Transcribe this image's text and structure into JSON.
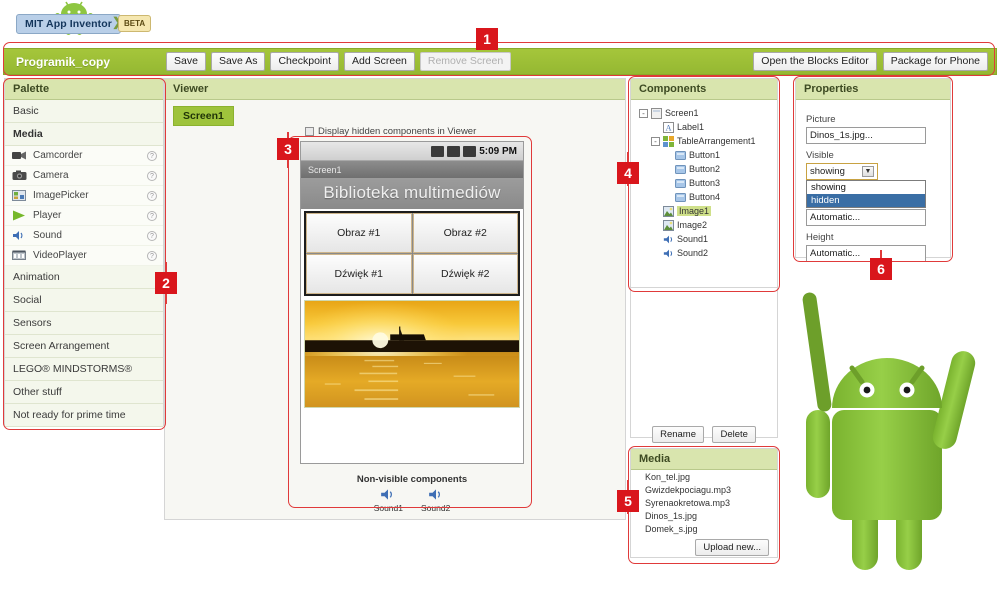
{
  "brand": {
    "name": "MIT App Inventor",
    "badge": "BETA",
    "logo_icon": "android-robot-icon"
  },
  "projectbar": {
    "project_name": "Programik_copy",
    "buttons": [
      {
        "label": "Save",
        "disabled": false
      },
      {
        "label": "Save As",
        "disabled": false
      },
      {
        "label": "Checkpoint",
        "disabled": false
      },
      {
        "label": "Add Screen",
        "disabled": false
      },
      {
        "label": "Remove Screen",
        "disabled": true
      }
    ],
    "right_buttons": [
      {
        "label": "Open the Blocks Editor"
      },
      {
        "label": "Package for Phone"
      }
    ]
  },
  "palette": {
    "title": "Palette",
    "groups": [
      {
        "label": "Basic",
        "bold": false,
        "open": false
      },
      {
        "label": "Media",
        "bold": true,
        "open": true
      },
      {
        "label": "Animation",
        "bold": false,
        "open": false
      },
      {
        "label": "Social",
        "bold": false,
        "open": false
      },
      {
        "label": "Sensors",
        "bold": false,
        "open": false
      },
      {
        "label": "Screen Arrangement",
        "bold": false,
        "open": false
      },
      {
        "label": "LEGO® MINDSTORMS®",
        "bold": false,
        "open": false
      },
      {
        "label": "Other stuff",
        "bold": false,
        "open": false
      },
      {
        "label": "Not ready for prime time",
        "bold": false,
        "open": false
      }
    ],
    "media_items": [
      {
        "label": "Camcorder",
        "icon": "camcorder-icon",
        "help": "?"
      },
      {
        "label": "Camera",
        "icon": "camera-icon",
        "help": "?"
      },
      {
        "label": "ImagePicker",
        "icon": "imagepicker-icon",
        "help": "?"
      },
      {
        "label": "Player",
        "icon": "player-play-icon",
        "help": "?"
      },
      {
        "label": "Sound",
        "icon": "sound-speaker-icon",
        "help": "?"
      },
      {
        "label": "VideoPlayer",
        "icon": "videoplayer-icon",
        "help": "?"
      }
    ]
  },
  "viewer": {
    "title": "Viewer",
    "screen_tab": "Screen1",
    "hidden_checkbox_label": "Display hidden components in Viewer",
    "hidden_checkbox_checked": false,
    "phone": {
      "status_time": "5:09 PM",
      "status_icons": [
        "signal-bars-icon",
        "network-icon",
        "battery-icon"
      ],
      "screen_title": "Screen1",
      "app_label": "Biblioteka multimediów",
      "buttons": [
        "Obraz #1",
        "Obraz #2",
        "Dźwięk #1",
        "Dźwięk #2"
      ],
      "image_alt": "sunset-harbor-photo"
    },
    "nonvisible_title": "Non-visible components",
    "nonvisible": [
      {
        "label": "Sound1",
        "icon": "sound-speaker-icon"
      },
      {
        "label": "Sound2",
        "icon": "sound-speaker-icon"
      }
    ]
  },
  "components": {
    "title": "Components",
    "tree": [
      {
        "label": "Screen1",
        "depth": 0,
        "toggle": "-",
        "icon": "screen-icon",
        "selected": false
      },
      {
        "label": "Label1",
        "depth": 1,
        "toggle": "",
        "icon": "label-icon",
        "selected": false
      },
      {
        "label": "TableArrangement1",
        "depth": 1,
        "toggle": "-",
        "icon": "table-icon",
        "selected": false
      },
      {
        "label": "Button1",
        "depth": 2,
        "toggle": "",
        "icon": "button-icon",
        "selected": false
      },
      {
        "label": "Button2",
        "depth": 2,
        "toggle": "",
        "icon": "button-icon",
        "selected": false
      },
      {
        "label": "Button3",
        "depth": 2,
        "toggle": "",
        "icon": "button-icon",
        "selected": false
      },
      {
        "label": "Button4",
        "depth": 2,
        "toggle": "",
        "icon": "button-icon",
        "selected": false
      },
      {
        "label": "Image1",
        "depth": 1,
        "toggle": "",
        "icon": "image-icon",
        "selected": true
      },
      {
        "label": "Image2",
        "depth": 1,
        "toggle": "",
        "icon": "image-icon",
        "selected": false
      },
      {
        "label": "Sound1",
        "depth": 1,
        "toggle": "",
        "icon": "sound-speaker-icon",
        "selected": false
      },
      {
        "label": "Sound2",
        "depth": 1,
        "toggle": "",
        "icon": "sound-speaker-icon",
        "selected": false
      }
    ],
    "rename_label": "Rename",
    "delete_label": "Delete"
  },
  "media_panel": {
    "title": "Media",
    "files": [
      "Kon_tel.jpg",
      "Gwizdekpociagu.mp3",
      "Syrenaokretowa.mp3",
      "Dinos_1s.jpg",
      "Domek_s.jpg"
    ],
    "upload_label": "Upload new..."
  },
  "properties": {
    "title": "Properties",
    "picture_label": "Picture",
    "picture_value": "Dinos_1s.jpg...",
    "visible_label": "Visible",
    "visible_value": "showing",
    "visible_options": [
      {
        "label": "showing",
        "selected": false
      },
      {
        "label": "hidden",
        "selected": true
      }
    ],
    "width_value": "Automatic...",
    "height_label": "Height",
    "height_value": "Automatic..."
  },
  "callouts": [
    {
      "number": "1"
    },
    {
      "number": "2"
    },
    {
      "number": "3"
    },
    {
      "number": "4"
    },
    {
      "number": "5"
    },
    {
      "number": "6"
    }
  ],
  "colors": {
    "accent_green": "#9ec33c",
    "panel_head": "#d9e5ae",
    "callout_red": "#d9161c",
    "selection_blue": "#3a6ea5",
    "robot_green": "#8ec641"
  }
}
